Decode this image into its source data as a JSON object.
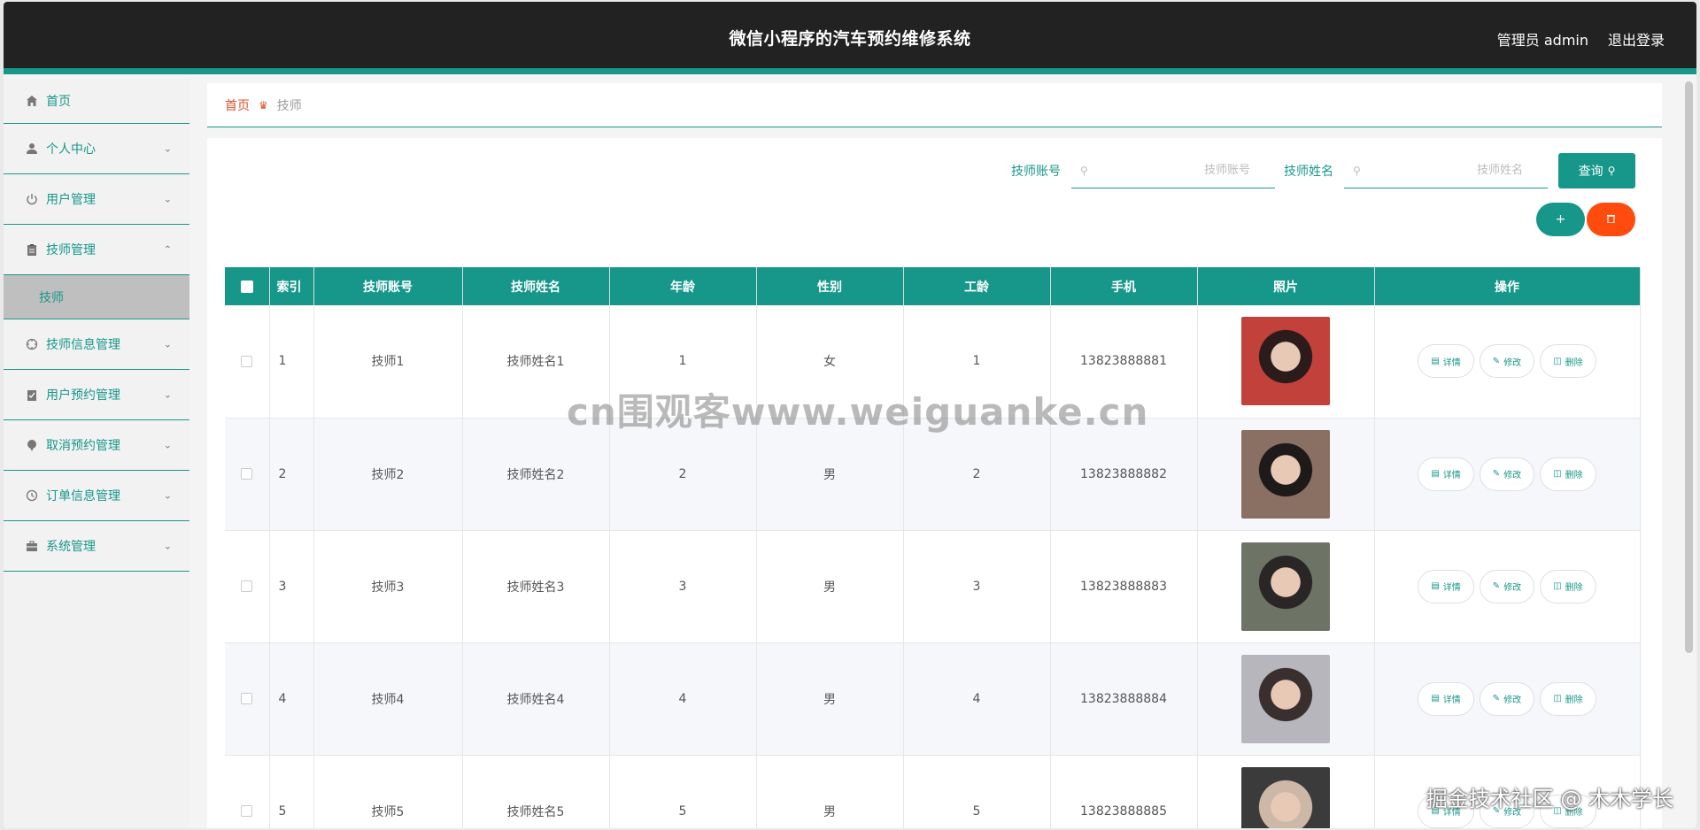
{
  "header": {
    "title": "微信小程序的汽车预约维修系统",
    "user": "管理员 admin",
    "logout": "退出登录"
  },
  "sidebar": {
    "items": [
      {
        "label": "首页",
        "icon": "home-icon",
        "expanded": false
      },
      {
        "label": "个人中心",
        "icon": "user-icon",
        "expanded": false
      },
      {
        "label": "用户管理",
        "icon": "power-icon",
        "expanded": false
      },
      {
        "label": "技师管理",
        "icon": "clipboard-icon",
        "expanded": true,
        "children": [
          "技师"
        ]
      },
      {
        "label": "技师信息管理",
        "icon": "target-icon",
        "expanded": false
      },
      {
        "label": "用户预约管理",
        "icon": "checklist-icon",
        "expanded": false
      },
      {
        "label": "取消预约管理",
        "icon": "pin-icon",
        "expanded": false
      },
      {
        "label": "订单信息管理",
        "icon": "clock-icon",
        "expanded": false
      },
      {
        "label": "系统管理",
        "icon": "briefcase-icon",
        "expanded": false
      }
    ],
    "sub_active": "技师"
  },
  "breadcrumb": {
    "home": "首页",
    "current": "技师"
  },
  "search": {
    "account_label": "技师账号",
    "account_placeholder": "技师账号",
    "name_label": "技师姓名",
    "name_placeholder": "技师姓名",
    "query_label": "查询"
  },
  "buttons": {
    "add": "+",
    "delete": "🗑"
  },
  "table": {
    "headers": [
      "",
      "索引",
      "技师账号",
      "技师姓名",
      "年龄",
      "性别",
      "工龄",
      "手机",
      "照片",
      "操作"
    ],
    "rows": [
      {
        "index": "1",
        "account": "技师1",
        "name": "技师姓名1",
        "age": "1",
        "gender": "女",
        "years": "1",
        "phone": "13823888881"
      },
      {
        "index": "2",
        "account": "技师2",
        "name": "技师姓名2",
        "age": "2",
        "gender": "男",
        "years": "2",
        "phone": "13823888882"
      },
      {
        "index": "3",
        "account": "技师3",
        "name": "技师姓名3",
        "age": "3",
        "gender": "男",
        "years": "3",
        "phone": "13823888883"
      },
      {
        "index": "4",
        "account": "技师4",
        "name": "技师姓名4",
        "age": "4",
        "gender": "男",
        "years": "4",
        "phone": "13823888884"
      },
      {
        "index": "5",
        "account": "技师5",
        "name": "技师姓名5",
        "age": "5",
        "gender": "男",
        "years": "5",
        "phone": "13823888885"
      }
    ],
    "ops": {
      "detail": "详情",
      "edit": "修改",
      "delete": "删除"
    }
  },
  "watermark": "cn围观客www.weiguanke.cn",
  "corner_mark": "掘金技术社区 @ 木木学长",
  "colors": {
    "accent": "#16978a",
    "danger": "#ff4b0e",
    "header_bg": "#222222"
  }
}
